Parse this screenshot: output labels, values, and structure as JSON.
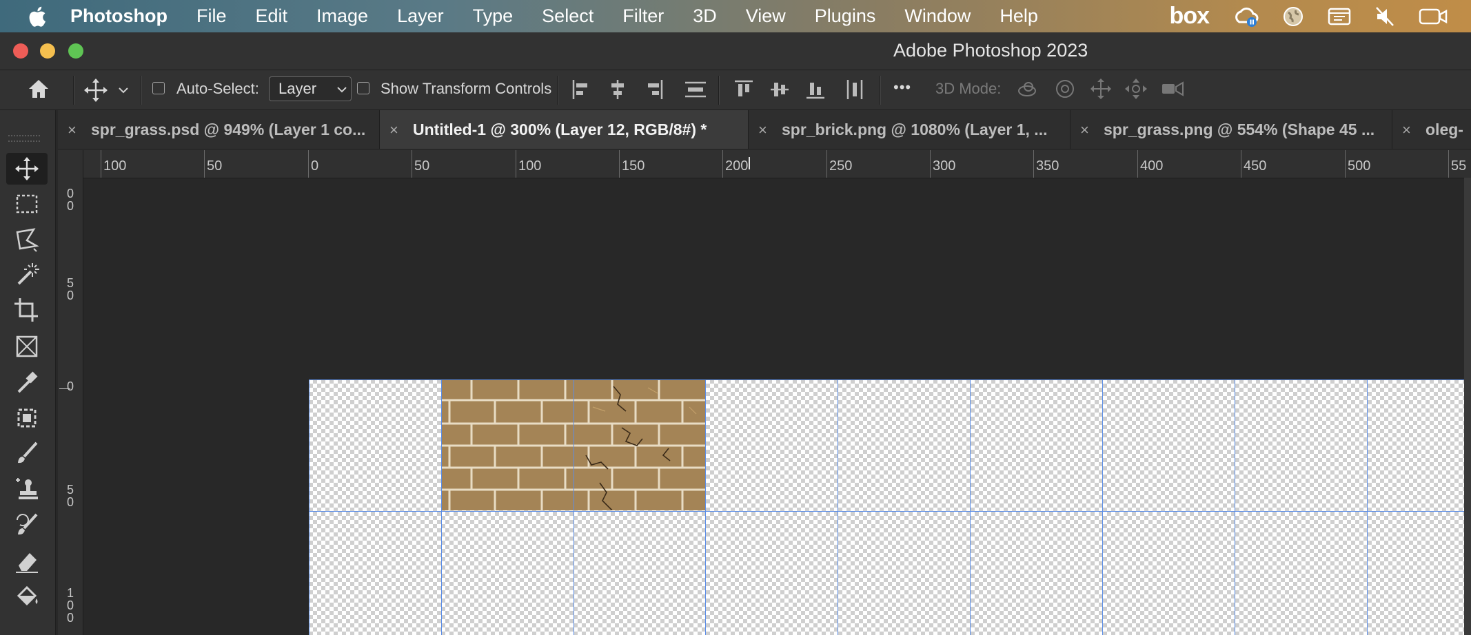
{
  "menubar": {
    "app_name": "Photoshop",
    "items": [
      "File",
      "Edit",
      "Image",
      "Layer",
      "Type",
      "Select",
      "Filter",
      "3D",
      "View",
      "Plugins",
      "Window",
      "Help"
    ],
    "status_box_label": "box"
  },
  "window": {
    "title": "Adobe Photoshop 2023"
  },
  "options": {
    "auto_select_label": "Auto-Select:",
    "auto_select_value": "Layer",
    "show_transform_label": "Show Transform Controls",
    "more": "•••",
    "mode_3d_label": "3D Mode:"
  },
  "panel_toggle": "››",
  "tabs": [
    {
      "label": "spr_grass.psd @ 949% (Layer 1 co...",
      "active": false
    },
    {
      "label": "Untitled-1 @ 300% (Layer 12, RGB/8#) *",
      "active": true
    },
    {
      "label": "spr_brick.png @ 1080% (Layer 1, ...",
      "active": false
    },
    {
      "label": "spr_grass.png @ 554% (Shape 45 ...",
      "active": false
    },
    {
      "label": "oleg-",
      "active": false
    }
  ],
  "tab_close_glyph": "×",
  "ruler_h": [
    "100",
    "50",
    "0",
    "50",
    "100",
    "150",
    "200",
    "250",
    "300",
    "350",
    "400",
    "450",
    "500",
    "55"
  ],
  "ruler_v": [
    {
      "d1": "0",
      "d2": "0"
    },
    {
      "d1": "5",
      "d2": "0"
    },
    {
      "d1": "0",
      "d2": ""
    },
    {
      "d1": "5",
      "d2": "0"
    },
    {
      "d1": "1",
      "d2": "0",
      "d3": "0"
    }
  ],
  "tools": [
    "move-tool-icon",
    "marquee-tool-icon",
    "lasso-tool-icon",
    "magic-wand-tool-icon",
    "crop-tool-icon",
    "frame-tool-icon",
    "eyedropper-tool-icon",
    "content-aware-tool-icon",
    "brush-tool-icon",
    "clone-stamp-tool-icon",
    "history-brush-tool-icon",
    "eraser-tool-icon",
    "paint-bucket-tool-icon"
  ],
  "colors": {
    "guide": "#5b8de6",
    "brick": "#a48456",
    "mortar": "#e8dcc4",
    "active_tab_bg": "#3b3b3b"
  }
}
